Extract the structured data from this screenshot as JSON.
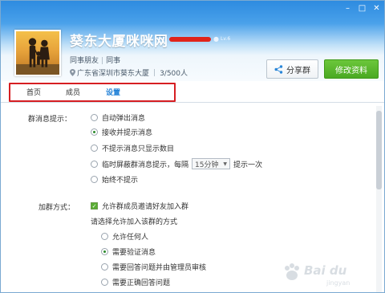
{
  "header": {
    "group_name": "葵东大厦咪咪网",
    "level_text": "Lv.6",
    "category_main": "同事朋友",
    "category_sub": "同事",
    "location": "广东省深圳市葵东大厦",
    "member_count": "3/500人",
    "share_label": "分享群",
    "edit_label": "修改资料"
  },
  "tabs": [
    {
      "label": "首页",
      "active": false
    },
    {
      "label": "成员",
      "active": false
    },
    {
      "label": "设置",
      "active": true
    }
  ],
  "settings": {
    "message_prompt_label": "群消息提示：",
    "message_options": [
      {
        "label": "自动弹出消息",
        "selected": false
      },
      {
        "label": "接收并提示消息",
        "selected": true
      },
      {
        "label": "不提示消息只显示数目",
        "selected": false
      },
      {
        "label": "临时屏蔽群消息提示，每隔",
        "selected": false,
        "select_value": "15分钟",
        "suffix": "提示一次"
      },
      {
        "label": "始终不提示",
        "selected": false
      }
    ],
    "join_label": "加群方式：",
    "allow_invite_label": "允许群成员邀请好友加入群",
    "allow_invite_checked": true,
    "choose_method_label": "请选择允许加入该群的方式",
    "join_options": [
      {
        "label": "允许任何人",
        "selected": false
      },
      {
        "label": "需要验证消息",
        "selected": true
      },
      {
        "label": "需要回答问题并由管理员审核",
        "selected": false
      },
      {
        "label": "需要正确回答问题",
        "selected": false
      }
    ]
  },
  "watermark": {
    "brand": "Bai du",
    "sub": "jingyan"
  },
  "colors": {
    "accent_blue": "#1e7fd6",
    "header_blue": "#2d8be0",
    "edit_green": "#4aa922",
    "highlight_red": "#d61e22"
  }
}
